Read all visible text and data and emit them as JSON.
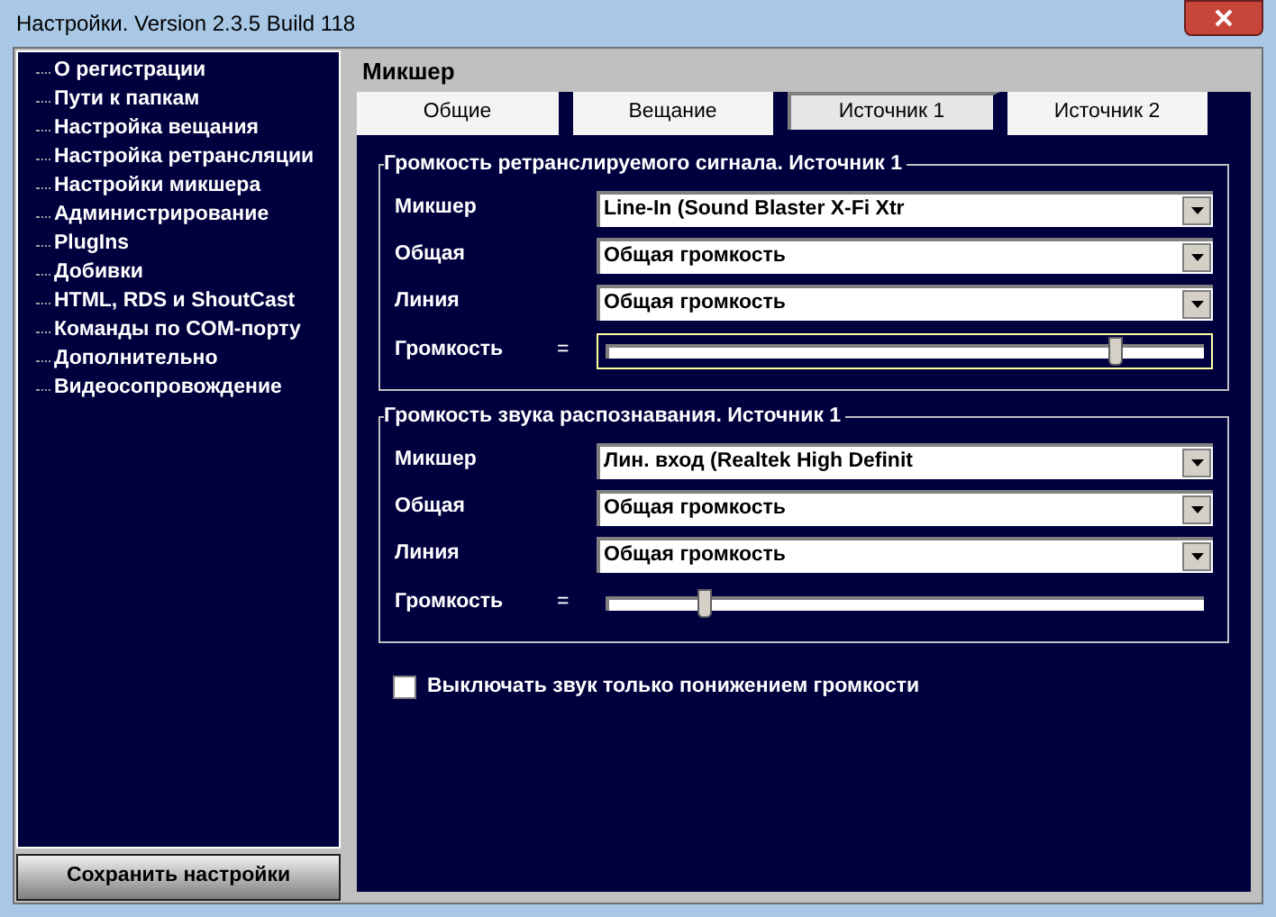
{
  "window": {
    "title": "Настройки. Version 2.3.5 Build 118"
  },
  "sidebar": {
    "items": [
      {
        "label": "О регистрации"
      },
      {
        "label": "Пути к папкам"
      },
      {
        "label": "Настройка вещания"
      },
      {
        "label": "Настройка ретрансляции"
      },
      {
        "label": "Настройки микшера"
      },
      {
        "label": "Администрирование"
      },
      {
        "label": "PlugIns"
      },
      {
        "label": "Добивки"
      },
      {
        "label": "HTML, RDS и ShoutCast"
      },
      {
        "label": "Команды по COM-порту"
      },
      {
        "label": "Дополнительно"
      },
      {
        "label": "Видеосопровождение"
      }
    ],
    "save_button": "Сохранить настройки"
  },
  "panel": {
    "title": "Микшер",
    "tabs": [
      {
        "label": "Общие",
        "selected": false
      },
      {
        "label": "Вещание",
        "selected": false
      },
      {
        "label": "Источник 1",
        "selected": true
      },
      {
        "label": "Источник 2",
        "selected": false
      }
    ],
    "groups": [
      {
        "title": "Громкость ретранслируемого сигнала. Источник 1",
        "highlighted": true,
        "rows": [
          {
            "label": "Микшер",
            "value": "Line-In (Sound Blaster X-Fi Xtr"
          },
          {
            "label": "Общая",
            "value": "Общая громкость"
          },
          {
            "label": "Линия",
            "value": "Общая громкость"
          }
        ],
        "volume": {
          "label": "Громкость",
          "sign": "=",
          "level": 0.85
        }
      },
      {
        "title": "Громкость звука распознавания. Источник 1",
        "highlighted": false,
        "rows": [
          {
            "label": "Микшер",
            "value": "Лин. вход (Realtek High Definit"
          },
          {
            "label": "Общая",
            "value": "Общая громкость"
          },
          {
            "label": "Линия",
            "value": "Общая громкость"
          }
        ],
        "volume": {
          "label": "Громкость",
          "sign": "=",
          "level": 0.16
        }
      }
    ],
    "mute_option": {
      "label": "Выключать звук только понижением громкости",
      "checked": false
    }
  }
}
